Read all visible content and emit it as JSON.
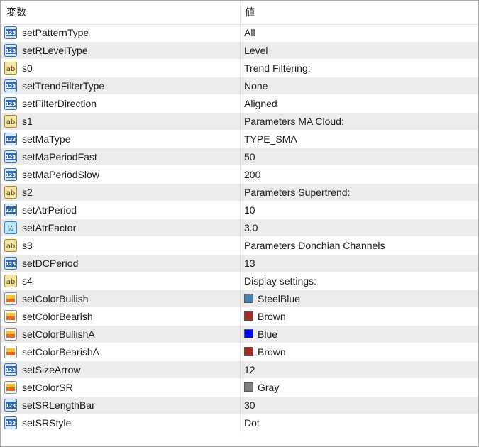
{
  "header": {
    "name_col": "変数",
    "value_col": "値"
  },
  "rows": [
    {
      "type": "int",
      "name": "setPatternType",
      "value": "All"
    },
    {
      "type": "int",
      "name": "setRLevelType",
      "value": "Level"
    },
    {
      "type": "string",
      "name": "s0",
      "value": "Trend Filtering:"
    },
    {
      "type": "int",
      "name": "setTrendFilterType",
      "value": "None"
    },
    {
      "type": "int",
      "name": "setFilterDirection",
      "value": "Aligned"
    },
    {
      "type": "string",
      "name": "s1",
      "value": "Parameters MA Cloud:"
    },
    {
      "type": "int",
      "name": "setMaType",
      "value": "TYPE_SMA"
    },
    {
      "type": "int",
      "name": "setMaPeriodFast",
      "value": "50"
    },
    {
      "type": "int",
      "name": "setMaPeriodSlow",
      "value": "200"
    },
    {
      "type": "string",
      "name": "s2",
      "value": "Parameters Supertrend:"
    },
    {
      "type": "int",
      "name": "setAtrPeriod",
      "value": "10"
    },
    {
      "type": "double",
      "name": "setAtrFactor",
      "value": "3.0"
    },
    {
      "type": "string",
      "name": "s3",
      "value": "Parameters Donchian Channels"
    },
    {
      "type": "int",
      "name": "setDCPeriod",
      "value": "13"
    },
    {
      "type": "string",
      "name": "s4",
      "value": "Display settings:"
    },
    {
      "type": "color",
      "name": "setColorBullish",
      "value": "SteelBlue",
      "color": "#4682B4"
    },
    {
      "type": "color",
      "name": "setColorBearish",
      "value": "Brown",
      "color": "#A52A2A"
    },
    {
      "type": "color",
      "name": "setColorBullishA",
      "value": "Blue",
      "color": "#0000FF"
    },
    {
      "type": "color",
      "name": "setColorBearishA",
      "value": "Brown",
      "color": "#A52A2A"
    },
    {
      "type": "int",
      "name": "setSizeArrow",
      "value": "12"
    },
    {
      "type": "color",
      "name": "setColorSR",
      "value": "Gray",
      "color": "#808080"
    },
    {
      "type": "int",
      "name": "setSRLengthBar",
      "value": "30"
    },
    {
      "type": "int",
      "name": "setSRStyle",
      "value": "Dot"
    }
  ],
  "icons": {
    "int": "integer-type-icon",
    "string": "string-type-icon",
    "double": "double-type-icon",
    "color": "color-type-icon"
  },
  "icon_labels": {
    "int": "123",
    "string": "ab",
    "double": "½"
  }
}
